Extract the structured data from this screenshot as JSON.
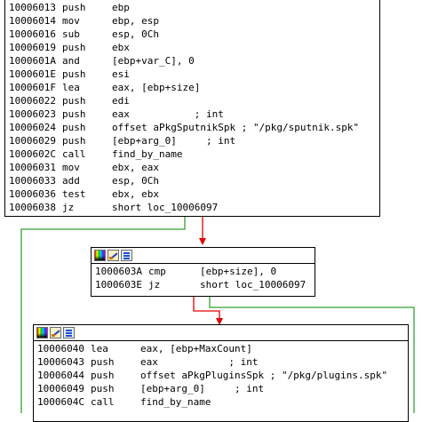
{
  "colors": {
    "edge_green": "#30a030",
    "edge_red": "#e00000",
    "node_border": "#000000",
    "background": "#ffffff"
  },
  "toolbar_icons": [
    "color-palette-icon",
    "edit-block-icon",
    "graph-view-icon"
  ],
  "block1": {
    "lines": [
      {
        "addr": "10006013",
        "mn": "push",
        "op": "ebp"
      },
      {
        "addr": "10006014",
        "mn": "mov",
        "op": "ebp, esp"
      },
      {
        "addr": "10006016",
        "mn": "sub",
        "op": "esp, 0Ch"
      },
      {
        "addr": "10006019",
        "mn": "push",
        "op": "ebx"
      },
      {
        "addr": "1000601A",
        "mn": "and",
        "op": "[ebp+var_C], 0"
      },
      {
        "addr": "1000601E",
        "mn": "push",
        "op": "esi"
      },
      {
        "addr": "1000601F",
        "mn": "lea",
        "op": "eax, [ebp+size]"
      },
      {
        "addr": "10006022",
        "mn": "push",
        "op": "edi"
      },
      {
        "addr": "10006023",
        "mn": "push",
        "op": "eax           ; int"
      },
      {
        "addr": "10006024",
        "mn": "push",
        "op": "offset aPkgSputnikSpk ; \"/pkg/sputnik.spk\""
      },
      {
        "addr": "10006029",
        "mn": "push",
        "op": "[ebp+arg_0]     ; int"
      },
      {
        "addr": "1000602C",
        "mn": "call",
        "op": "find_by_name"
      },
      {
        "addr": "10006031",
        "mn": "mov",
        "op": "ebx, eax"
      },
      {
        "addr": "10006033",
        "mn": "add",
        "op": "esp, 0Ch"
      },
      {
        "addr": "10006036",
        "mn": "test",
        "op": "ebx, ebx"
      },
      {
        "addr": "10006038",
        "mn": "jz",
        "op": "short loc_10006097"
      }
    ]
  },
  "block2": {
    "lines": [
      {
        "addr": "1000603A",
        "mn": "cmp",
        "op": "[ebp+size], 0"
      },
      {
        "addr": "1000603E",
        "mn": "jz",
        "op": "short loc_10006097"
      }
    ]
  },
  "block3": {
    "lines": [
      {
        "addr": "10006040",
        "mn": "lea",
        "op": "eax, [ebp+MaxCount]"
      },
      {
        "addr": "10006043",
        "mn": "push",
        "op": "eax            ; int"
      },
      {
        "addr": "10006044",
        "mn": "push",
        "op": "offset aPkgPluginsSpk ; \"/pkg/plugins.spk\""
      },
      {
        "addr": "10006049",
        "mn": "push",
        "op": "[ebp+arg_0]     ; int"
      },
      {
        "addr": "1000604C",
        "mn": "call",
        "op": "find_by_name"
      }
    ]
  }
}
